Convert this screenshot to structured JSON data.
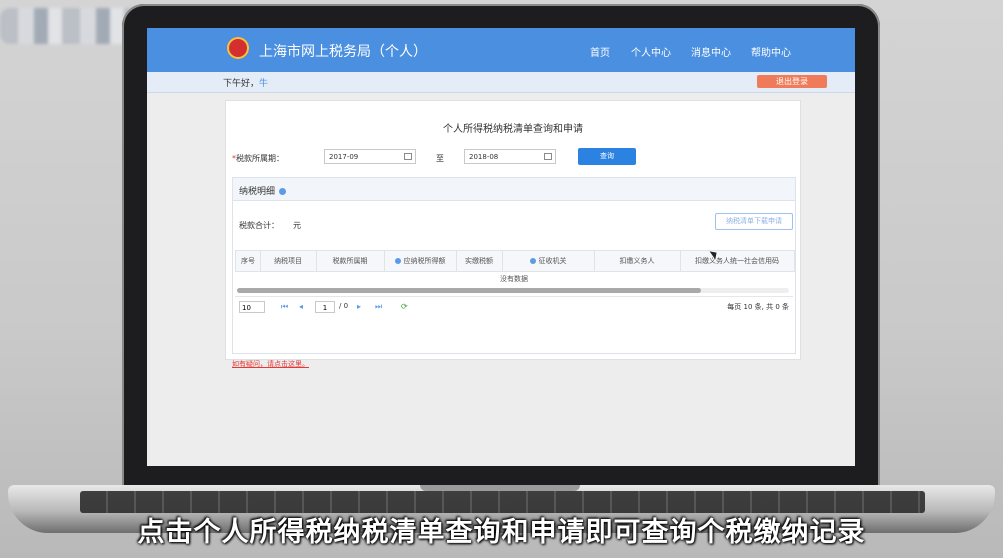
{
  "site": {
    "title": "上海市网上税务局（个人）",
    "nav": [
      "首页",
      "个人中心",
      "消息中心",
      "帮助中心"
    ],
    "greeting": "下午好，",
    "user_name": "牛",
    "logout": "退出登录",
    "brand_color": "#4b8fe0"
  },
  "query": {
    "page_title": "个人所得税纳税清单查询和申请",
    "period_label": "税款所属期：",
    "required_mark": "*",
    "from_value": "2017-09",
    "to_label": "至",
    "to_value": "2018-08",
    "search_button": "查询"
  },
  "details": {
    "section_title": "纳税明细",
    "total_label": "税款合计：",
    "total_unit": "元",
    "download_button": "纳税清单下载申请",
    "columns": [
      "序号",
      "纳税项目",
      "税款所属期",
      "应纳税所得额",
      "实缴税额",
      "征收机关",
      "扣缴义务人",
      "扣缴义务人统一社会信用码"
    ],
    "no_data": "没有数据",
    "pager": {
      "page_size": "10",
      "page_number": "1",
      "page_total": "/ 0",
      "summary": "每页 10 条, 共 0 条"
    },
    "warning_link": "如有疑问，请点击这里。"
  },
  "subtitle": "点击个人所得税纳税清单查询和申请即可查询个税缴纳记录"
}
